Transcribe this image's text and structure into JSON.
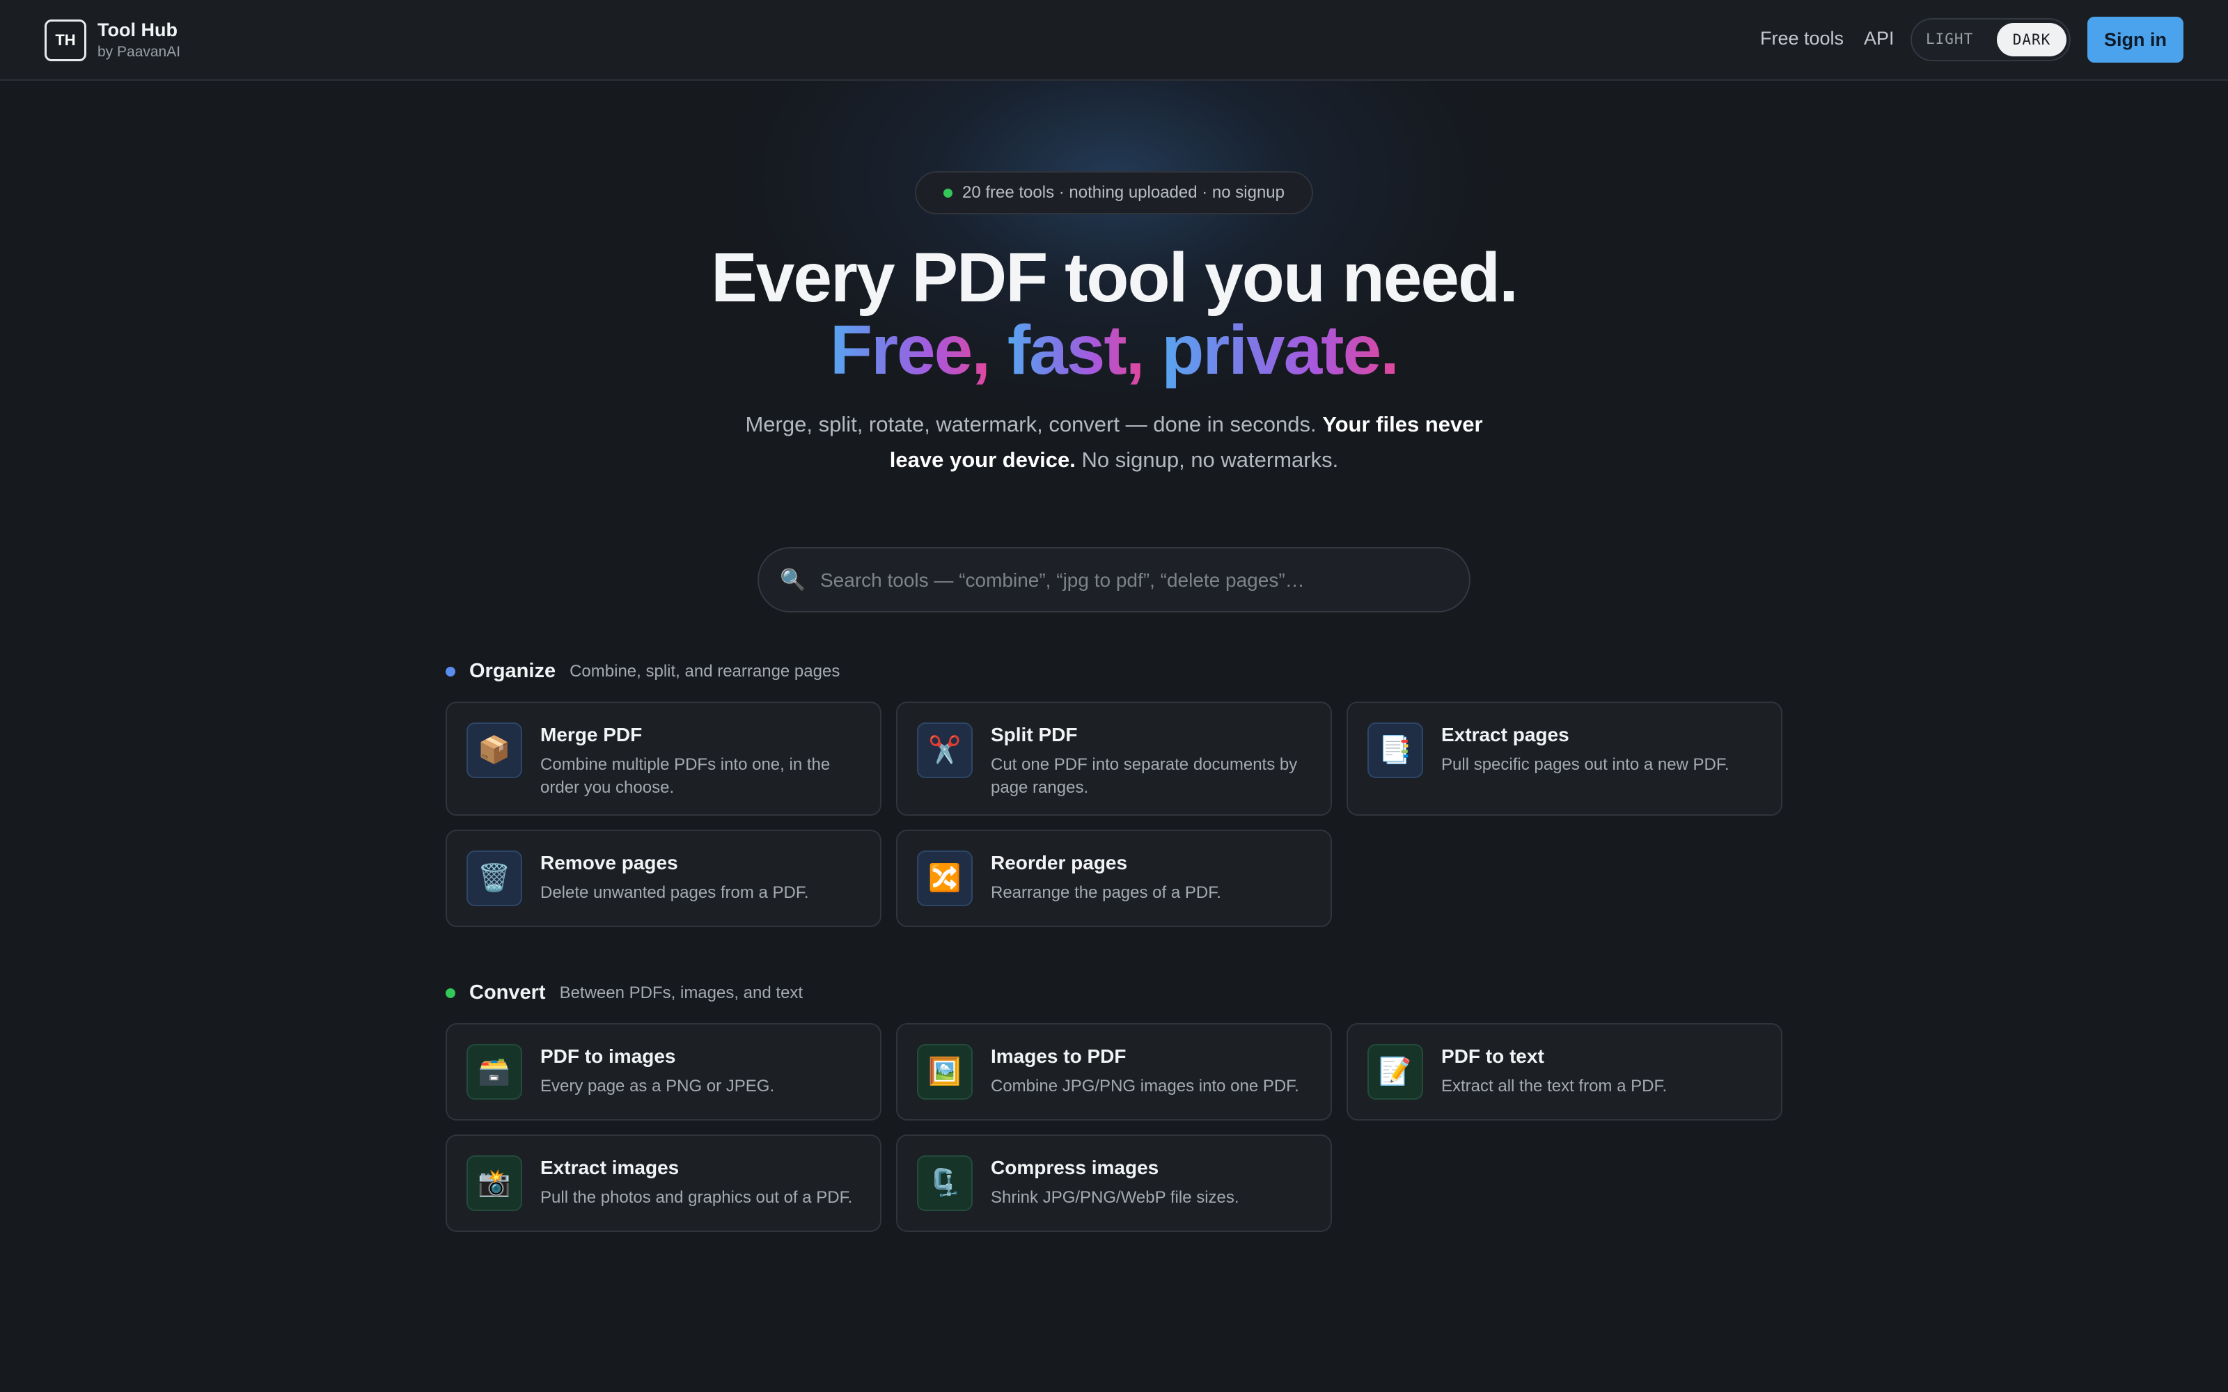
{
  "header": {
    "logo": "TH",
    "brand_name": "Tool Hub",
    "brand_sub": "by PaavanAI",
    "nav_free_tools": "Free tools",
    "nav_api": "API",
    "theme_light": "LIGHT",
    "theme_dark": "DARK",
    "sign_in": "Sign in"
  },
  "hero": {
    "pill_text": "20 free tools · nothing uploaded · no signup",
    "title_line1": "Every PDF tool you need.",
    "title_free": "Free,",
    "title_fast": "fast,",
    "title_private": "private.",
    "lead_plain1": "Merge, split, rotate, watermark, convert — done in seconds. ",
    "lead_bold": "Your files never leave your device.",
    "lead_plain2": " No signup, no watermarks."
  },
  "search": {
    "icon": "🔍",
    "placeholder": "Search tools — “combine”, “jpg to pdf”, “delete pages”…"
  },
  "colors": {
    "accent": "#4aa3ec",
    "organize_dot": "#5b8def",
    "convert_dot": "#34c759",
    "status_dot": "#34c759"
  },
  "sections": {
    "organize": {
      "title": "Organize",
      "desc": "Combine, split, and rearrange pages",
      "tools": [
        {
          "icon": "📦",
          "title": "Merge PDF",
          "desc": "Combine multiple PDFs into one, in the order you choose."
        },
        {
          "icon": "✂️",
          "title": "Split PDF",
          "desc": "Cut one PDF into separate documents by page ranges."
        },
        {
          "icon": "📑",
          "title": "Extract pages",
          "desc": "Pull specific pages out into a new PDF."
        },
        {
          "icon": "🗑️",
          "title": "Remove pages",
          "desc": "Delete unwanted pages from a PDF."
        },
        {
          "icon": "🔀",
          "title": "Reorder pages",
          "desc": "Rearrange the pages of a PDF."
        }
      ]
    },
    "convert": {
      "title": "Convert",
      "desc": "Between PDFs, images, and text",
      "tools": [
        {
          "icon": "🗃️",
          "title": "PDF to images",
          "desc": "Every page as a PNG or JPEG."
        },
        {
          "icon": "🖼️",
          "title": "Images to PDF",
          "desc": "Combine JPG/PNG images into one PDF."
        },
        {
          "icon": "📝",
          "title": "PDF to text",
          "desc": "Extract all the text from a PDF."
        },
        {
          "icon": "📸",
          "title": "Extract images",
          "desc": "Pull the photos and graphics out of a PDF."
        },
        {
          "icon": "🗜️",
          "title": "Compress images",
          "desc": "Shrink JPG/PNG/WebP file sizes."
        }
      ]
    }
  }
}
